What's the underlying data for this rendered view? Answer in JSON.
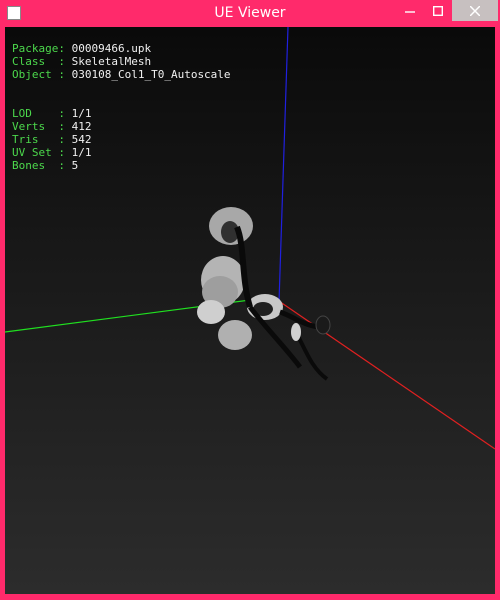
{
  "window": {
    "title": "UE Viewer",
    "accent": "#ff2a6b",
    "icons": {
      "app": "app-icon",
      "minimize": "minimize-icon",
      "maximize": "maximize-icon",
      "close": "close-icon"
    }
  },
  "info": {
    "package_label": "Package:",
    "package_value": "00009466.upk",
    "class_label": "Class  :",
    "class_value": "SkeletalMesh",
    "object_label": "Object :",
    "object_value": "030108_Col1_T0_Autoscale",
    "lod_label": "LOD    :",
    "lod_value": "1/1",
    "verts_label": "Verts  :",
    "verts_value": "412",
    "tris_label": "Tris   :",
    "tris_value": "542",
    "uvset_label": "UV Set :",
    "uvset_value": "1/1",
    "bones_label": "Bones  :",
    "bones_value": "5",
    "label_color": "#4cd84c",
    "value_color": "#f0f0f0"
  },
  "axes": {
    "x_color": "#e02020",
    "y_color": "#20e020",
    "z_color": "#2020e0"
  }
}
